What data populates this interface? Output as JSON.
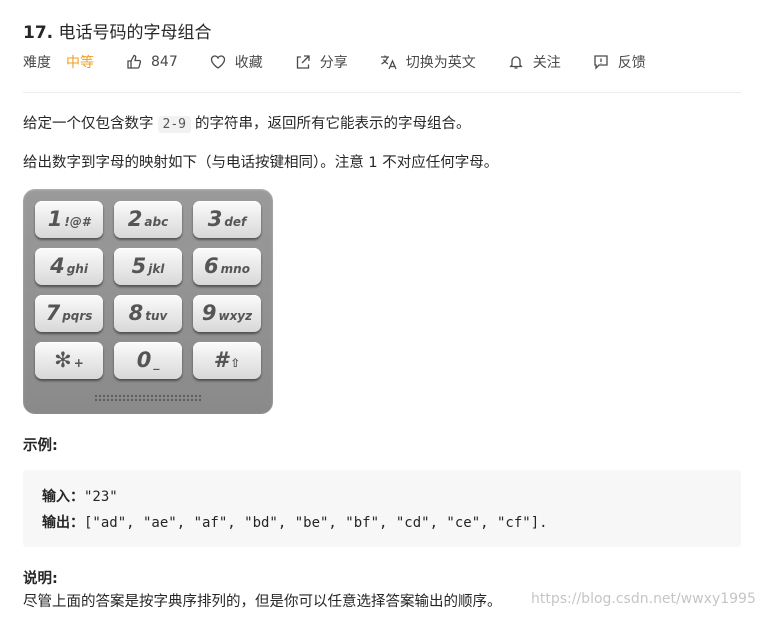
{
  "problem": {
    "number": "17.",
    "title": "电话号码的字母组合"
  },
  "meta": {
    "difficulty_label": "难度",
    "difficulty": "中等",
    "likes": "847",
    "favorite_label": "收藏",
    "share_label": "分享",
    "language_label": "切换为英文",
    "follow_label": "关注",
    "feedback_label": "反馈",
    "colors": {
      "difficulty": "#ef9f21"
    }
  },
  "description": {
    "para1_before": "给定一个仅包含数字",
    "para1_code": "2-9",
    "para1_after": "的字符串，返回所有它能表示的字母组合。",
    "para2": "给出数字到字母的映射如下（与电话按键相同）。注意 1 不对应任何字母。"
  },
  "keypad": {
    "keys": [
      {
        "digit": "1",
        "letters": "!@#"
      },
      {
        "digit": "2",
        "letters": "abc"
      },
      {
        "digit": "3",
        "letters": "def"
      },
      {
        "digit": "4",
        "letters": "ghi"
      },
      {
        "digit": "5",
        "letters": "jkl"
      },
      {
        "digit": "6",
        "letters": "mno"
      },
      {
        "digit": "7",
        "letters": "pqrs"
      },
      {
        "digit": "8",
        "letters": "tuv"
      },
      {
        "digit": "9",
        "letters": "wxyz"
      },
      {
        "digit": "✻",
        "letters": "+"
      },
      {
        "digit": "0",
        "letters": "_"
      },
      {
        "digit": "#",
        "letters": "⇧"
      }
    ]
  },
  "example": {
    "heading": "示例:",
    "input_label": "输入：",
    "input_value": "\"23\"",
    "output_label": "输出：",
    "output_value": "[\"ad\", \"ae\", \"af\", \"bd\", \"be\", \"bf\", \"cd\", \"ce\", \"cf\"]."
  },
  "note": {
    "heading": "说明:",
    "text": "尽管上面的答案是按字典序排列的，但是你可以任意选择答案输出的顺序。"
  },
  "watermark": "https://blog.csdn.net/wwxy1995"
}
